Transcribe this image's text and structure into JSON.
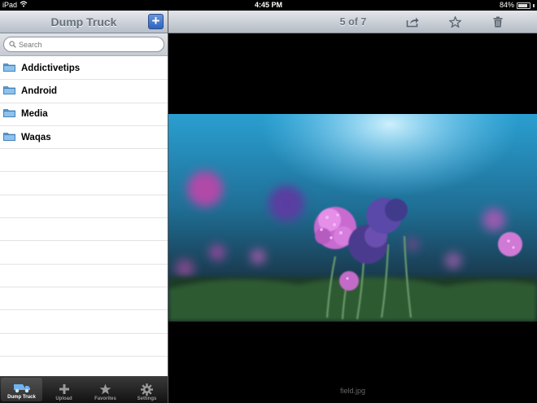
{
  "status_bar": {
    "device": "iPad",
    "time": "4:45 PM",
    "battery": "84%",
    "battery_level": 0.84
  },
  "sidebar": {
    "title": "Dump Truck",
    "add_label": "+",
    "search": {
      "placeholder": "Search",
      "value": ""
    },
    "folders": [
      {
        "label": "Addictivetips"
      },
      {
        "label": "Android"
      },
      {
        "label": "Media"
      },
      {
        "label": "Waqas"
      }
    ]
  },
  "tabs": [
    {
      "label": "Dump Truck",
      "icon": "truck-icon",
      "active": true
    },
    {
      "label": "Upload",
      "icon": "plus-icon",
      "active": false
    },
    {
      "label": "Favorites",
      "icon": "star-icon",
      "active": false
    },
    {
      "label": "Settings",
      "icon": "gear-icon",
      "active": false
    }
  ],
  "viewer": {
    "pager": "5 of 7",
    "toolbar_icons": [
      "share-icon",
      "star-icon",
      "trash-icon"
    ],
    "caption": "field.jpg"
  },
  "colors": {
    "accent": "#2d64c0",
    "toolbar": "#b4bbc5",
    "folder": "#5b9fd6"
  }
}
